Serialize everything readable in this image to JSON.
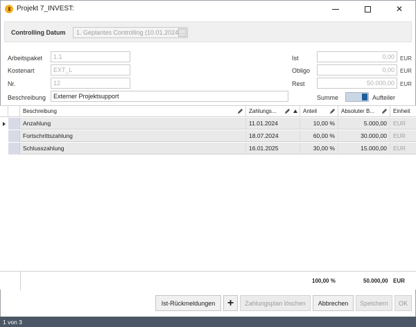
{
  "window": {
    "title": "Projekt 7_INVEST:",
    "app_icon": "app-icon",
    "minimize_icon": "minimize-icon",
    "maximize_icon": "maximize-icon",
    "close_icon": "close-icon"
  },
  "controlling": {
    "label": "Controlling Datum",
    "value": "1. Geplantes Controlling (10.01.2024)"
  },
  "form": {
    "arbeitspaket_label": "Arbeitspaket",
    "arbeitspaket_value": "1.1",
    "kostenart_label": "Kostenart",
    "kostenart_value": "EXT_L",
    "nr_label": "Nr.",
    "nr_value": "12",
    "beschreibung_label": "Beschreibung",
    "beschreibung_value": "Externer Projektsupport",
    "ist_label": "Ist",
    "ist_value": "0,00",
    "obligo_label": "Obligo",
    "obligo_value": "0,00",
    "rest_label": "Rest",
    "rest_value": "50.000,00",
    "currency": "EUR",
    "toggle_left": "Summe",
    "toggle_right": "Aufteiler"
  },
  "grid": {
    "columns": [
      "Beschreibung",
      "Zahlungs...",
      "Anteil",
      "Absoluter B...",
      "Einheit"
    ],
    "rows": [
      {
        "beschreibung": "Anzahlung",
        "datum": "11.01.2024",
        "anteil": "10,00 %",
        "betrag": "5.000,00",
        "einheit": "EUR"
      },
      {
        "beschreibung": "Fortschrittszahlung",
        "datum": "18.07.2024",
        "anteil": "60,00 %",
        "betrag": "30.000,00",
        "einheit": "EUR"
      },
      {
        "beschreibung": "Schlusszahlung",
        "datum": "16.01.2025",
        "anteil": "30,00 %",
        "betrag": "15.000,00",
        "einheit": "EUR"
      }
    ],
    "footer": {
      "anteil_total": "100,00 %",
      "betrag_total": "50.000,00",
      "einheit": "EUR"
    }
  },
  "buttons": {
    "ist_rueckmeldungen": "Ist-Rückmeldungen",
    "add": "+",
    "zahlungsplan_loeschen": "Zahlungsplan löschen",
    "abbrechen": "Abbrechen",
    "speichern": "Speichern",
    "ok": "OK"
  },
  "status": {
    "text": "1 von 3"
  },
  "colors": {
    "status_bar": "#4b5766",
    "toggle_accent": "#1f5f9f",
    "row_bg": "#e9e9e9"
  }
}
